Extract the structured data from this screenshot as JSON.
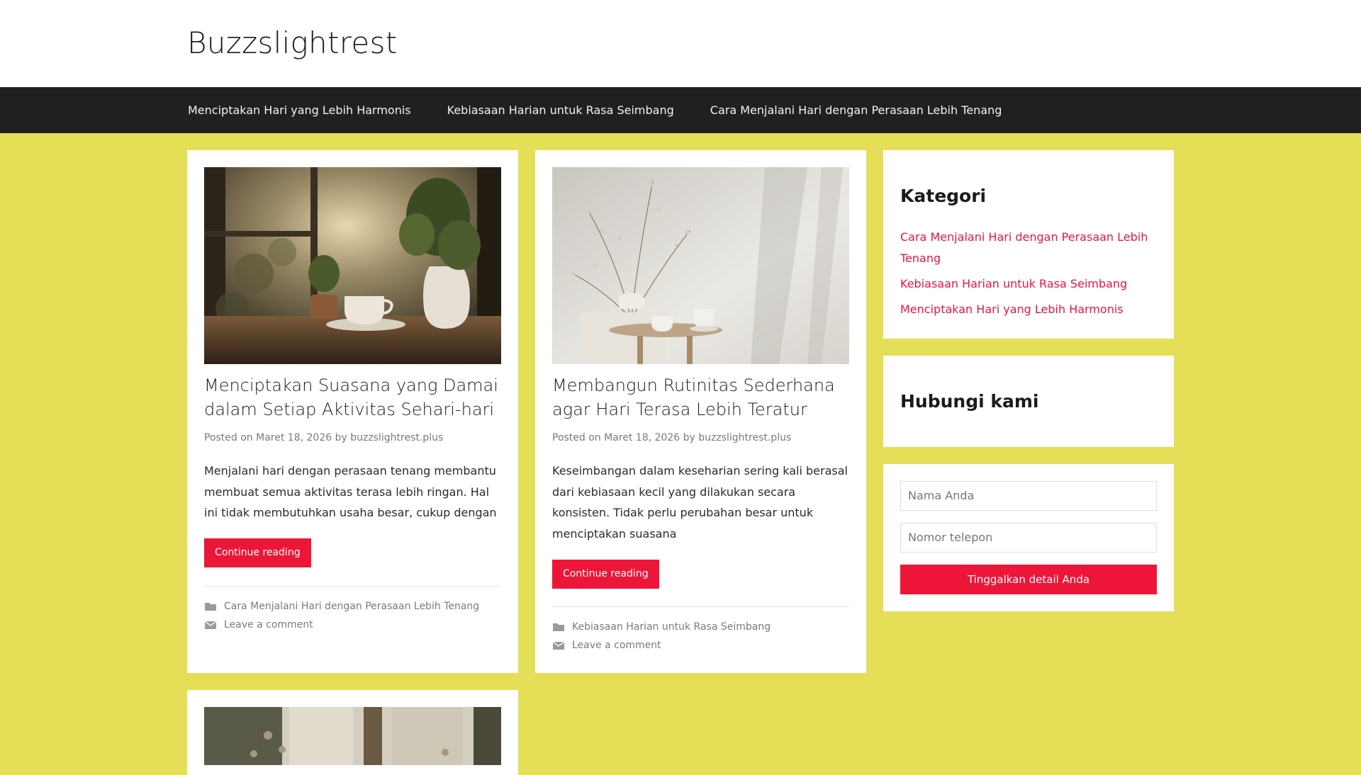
{
  "site": {
    "title": "Buzzslightrest"
  },
  "nav": {
    "items": [
      {
        "label": "Menciptakan Hari yang Lebih Harmonis"
      },
      {
        "label": "Kebiasaan Harian untuk Rasa Seimbang"
      },
      {
        "label": "Cara Menjalani Hari dengan Perasaan Lebih Tenang"
      }
    ]
  },
  "posts": [
    {
      "title": "Menciptakan Suasana yang Damai dalam Setiap Aktivitas Sehari-hari",
      "meta_posted": "Posted on",
      "date": "Maret 18, 2026",
      "meta_by": "by",
      "author": "buzzslightrest.plus",
      "excerpt": "Menjalani hari dengan perasaan tenang membantu membuat semua aktivitas terasa lebih ringan. Hal ini tidak membutuhkan usaha besar, cukup dengan",
      "read_more": "Continue reading",
      "category": "Cara Menjalani Hari dengan Perasaan Lebih Tenang",
      "comment": "Leave a comment",
      "image": "window-coffee-plant-photo"
    },
    {
      "title": "Membangun Rutinitas Sederhana agar Hari Terasa Lebih Teratur",
      "meta_posted": "Posted on",
      "date": "Maret 18, 2026",
      "meta_by": "by",
      "author": "buzzslightrest.plus",
      "excerpt": "Keseimbangan dalam keseharian sering kali berasal dari kebiasaan kecil yang dilakukan secara konsisten. Tidak perlu perubahan besar untuk menciptakan suasana",
      "read_more": "Continue reading",
      "category": "Kebiasaan Harian untuk Rasa Seimbang",
      "comment": "Leave a comment",
      "image": "dried-flowers-teacup-photo"
    },
    {
      "image": "window-dried-flowers-photo"
    }
  ],
  "sidebar": {
    "categories": {
      "title": "Kategori",
      "items": [
        {
          "label": "Cara Menjalani Hari dengan Perasaan Lebih Tenang"
        },
        {
          "label": "Kebiasaan Harian untuk Rasa Seimbang"
        },
        {
          "label": "Menciptakan Hari yang Lebih Harmonis"
        }
      ]
    },
    "contact": {
      "title": "Hubungi kami"
    },
    "form": {
      "name_placeholder": "Nama Anda",
      "phone_placeholder": "Nomor telepon",
      "submit_label": "Tinggalkan detail Anda"
    }
  },
  "colors": {
    "page_background": "#e5de57",
    "nav_background": "#202020",
    "accent": "#ed1639",
    "link": "#e8163d"
  },
  "icons": {
    "category": "folder-icon",
    "comment": "envelope-icon"
  }
}
